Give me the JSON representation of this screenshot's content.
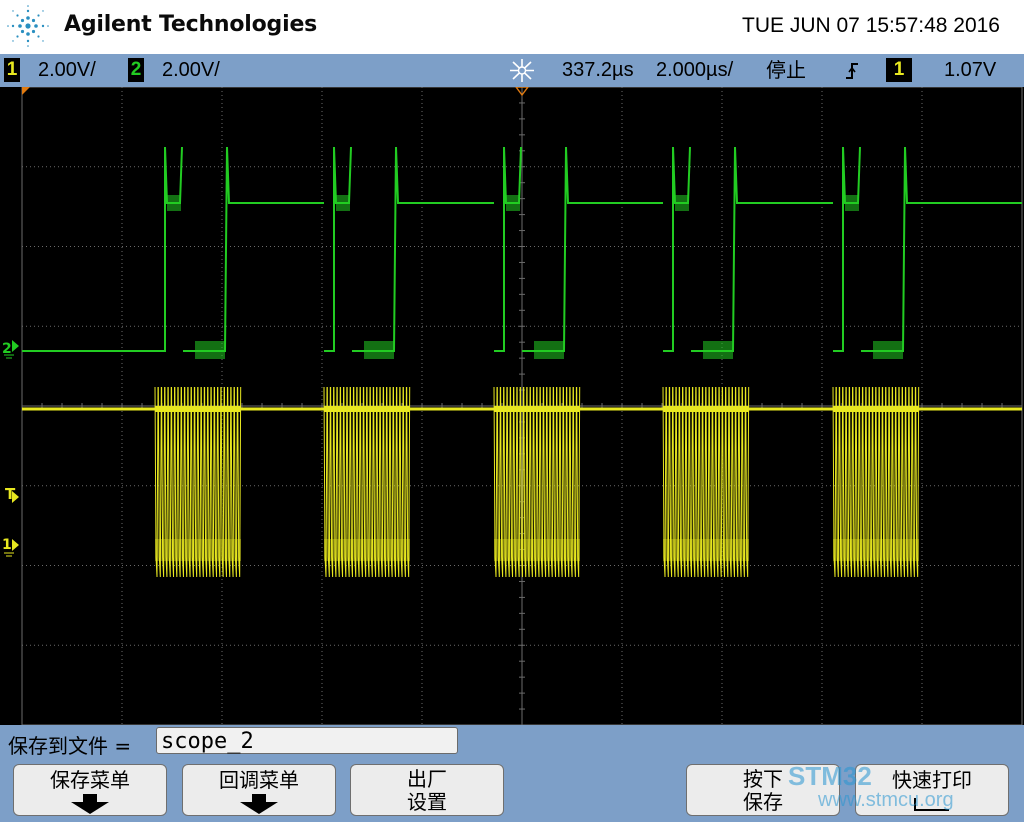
{
  "header": {
    "brand": "Agilent Technologies",
    "datetime": "TUE JUN 07 15:57:48 2016"
  },
  "status_bar": {
    "ch1_label": "1",
    "ch1_scale": "2.00V/",
    "ch2_label": "2",
    "ch2_scale": "2.00V/",
    "delay": "337.2µs",
    "timebase": "2.000µs/",
    "run_state": "停止",
    "trigger_source": "1",
    "trigger_level": "1.07V"
  },
  "markers": {
    "ch2": "2",
    "trigger": "T",
    "ch1": "1"
  },
  "file": {
    "label": "保存到文件 =",
    "value": "scope_2"
  },
  "softkeys": {
    "save_menu": "保存菜单",
    "recall_menu": "回调菜单",
    "factory_line1": "出厂",
    "factory_line2": "设置",
    "press_line1": "按下",
    "press_line2": "保存",
    "quick_print": "快速打印"
  },
  "watermark": {
    "text": "STM32",
    "url": "www.stmcu.org"
  },
  "colors": {
    "ch1": "#e8e820",
    "ch2": "#22cc22",
    "grid": "#6b6b6b",
    "screen": "#000000",
    "bar": "#7d9fc8"
  },
  "icons": {
    "logo": "agilent-spark-icon",
    "trigger_delay": "trigger-delay-icon",
    "edge": "rising-edge-icon"
  }
}
